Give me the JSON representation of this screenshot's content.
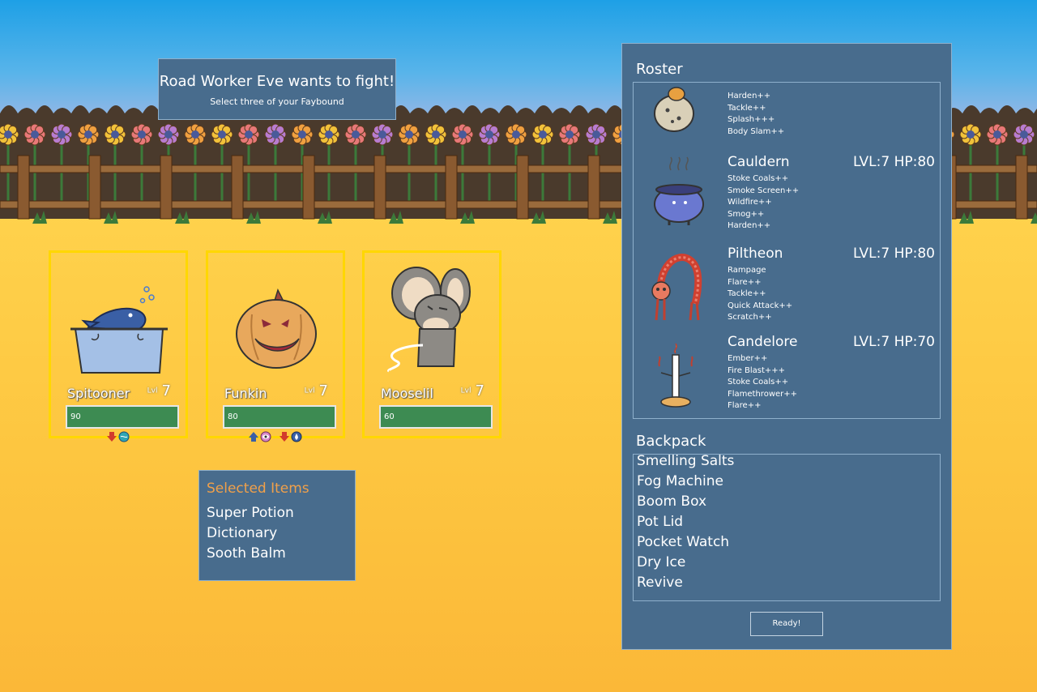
{
  "encounter": {
    "title": "Road Worker Eve wants to fight!",
    "subtitle": "Select three of your Faybound"
  },
  "party": [
    {
      "name": "Spitooner",
      "level_label": "Lvl",
      "level": "7",
      "hp": "90",
      "status_icons": [
        "arrow-down-icon",
        "water-icon"
      ]
    },
    {
      "name": "Funkin",
      "level_label": "Lvl",
      "level": "7",
      "hp": "80",
      "status_icons": [
        "arrow-up-icon",
        "eye-icon",
        "arrow-down-icon",
        "drop-icon"
      ]
    },
    {
      "name": "Mooselil",
      "level_label": "Lvl",
      "level": "7",
      "hp": "60",
      "status_icons": []
    }
  ],
  "selected_items": {
    "title": "Selected Items",
    "items": [
      "Super Potion",
      "Dictionary",
      "Sooth Balm"
    ]
  },
  "roster": {
    "title": "Roster",
    "faybound": [
      {
        "name": "",
        "stats": "",
        "moves": [
          "Harden++",
          "Tackle++",
          "Splash+++",
          "Body Slam++"
        ]
      },
      {
        "name": "Cauldern",
        "stats": "LVL:7 HP:80",
        "moves": [
          "Stoke Coals++",
          "Smoke Screen++",
          "Wildfire++",
          "Smog++",
          "Harden++"
        ]
      },
      {
        "name": "Piltheon",
        "stats": "LVL:7 HP:80",
        "moves": [
          "Rampage",
          "Flare++",
          "Tackle++",
          "Quick Attack++",
          "Scratch++"
        ]
      },
      {
        "name": "Candelore",
        "stats": "LVL:7 HP:70",
        "moves": [
          "Ember++",
          "Fire Blast+++",
          "Stoke Coals++",
          "Flamethrower++",
          "Flare++"
        ]
      }
    ]
  },
  "backpack": {
    "title": "Backpack",
    "items": [
      "Smelling Salts",
      "Fog Machine",
      "Boom Box",
      "Pot Lid",
      "Pocket Watch",
      "Dry Ice",
      "Revive"
    ]
  },
  "ready_label": "Ready!",
  "colors": {
    "panel": "#486c8d",
    "hp_bar": "#3d8b52",
    "card_border": "#ffd700",
    "items_title": "#f0a04a"
  }
}
